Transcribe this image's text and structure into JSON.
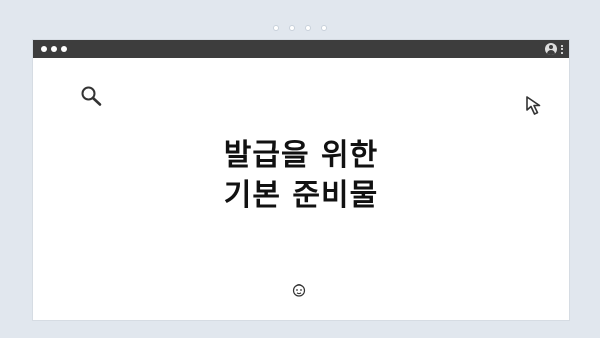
{
  "card": {
    "title_line1": "발급을 위한",
    "title_line2": "기본 준비물"
  },
  "icons": {
    "search": "search-icon",
    "cursor": "cursor-arrow-icon",
    "face": "face-icon",
    "user": "user-icon",
    "menu": "kebab-menu-icon"
  },
  "colors": {
    "background": "#e1e7ee",
    "titlebar": "#3d3d3d",
    "window": "#ffffff",
    "text": "#111111"
  }
}
